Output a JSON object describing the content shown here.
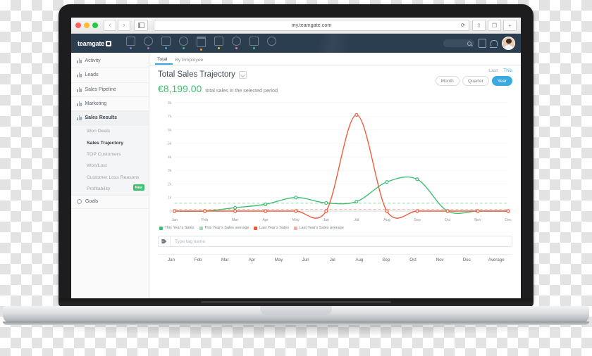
{
  "browser": {
    "url": "my.teamgate.com",
    "back_label": "‹",
    "forward_label": "›",
    "reload_label": "⟳",
    "sidebar_toggle_name": "sidebar-toggle",
    "share_label": "⇧",
    "tabs_label": "❐"
  },
  "appnav": {
    "logo_text": "teamgate",
    "icons": [
      {
        "name": "dashboard-icon",
        "dot": "#8e6fd8",
        "shape": "grid"
      },
      {
        "name": "leads-icon",
        "dot": "#c45fd0",
        "shape": "circ"
      },
      {
        "name": "pipeline-icon",
        "dot": "#4aa3e0",
        "shape": "grid"
      },
      {
        "name": "contacts-icon",
        "dot": "#3fbf72",
        "shape": "circ"
      },
      {
        "name": "deals-icon",
        "dot": "#f0922b",
        "shape": "brief"
      },
      {
        "name": "calendar-icon",
        "dot": "#f0c419",
        "shape": "grid"
      },
      {
        "name": "reports-icon",
        "dot": "#e87fae",
        "shape": "circ"
      },
      {
        "name": "library-icon",
        "dot": "#3fbf72",
        "shape": "grid"
      },
      {
        "name": "settings-icon",
        "dot": "",
        "shape": "circ"
      }
    ],
    "search_placeholder": "",
    "notes_icon": "notes-icon",
    "bell_icon": "bell-icon",
    "avatar_name": "user-avatar"
  },
  "sidebar": {
    "items": [
      {
        "label": "Activity",
        "icon": "bar-chart-icon",
        "active": false
      },
      {
        "label": "Leads",
        "icon": "bar-chart-icon",
        "active": false
      },
      {
        "label": "Sales Pipeline",
        "icon": "bar-chart-icon",
        "active": false
      },
      {
        "label": "Marketing",
        "icon": "bar-chart-icon",
        "active": false
      },
      {
        "label": "Sales Results",
        "icon": "bar-chart-icon",
        "active": true
      }
    ],
    "subitems": [
      {
        "label": "Won Deals",
        "selected": false,
        "badge": ""
      },
      {
        "label": "Sales Trajectory",
        "selected": true,
        "badge": ""
      },
      {
        "label": "TOP Customers",
        "selected": false,
        "badge": ""
      },
      {
        "label": "Won/Lost",
        "selected": false,
        "badge": ""
      },
      {
        "label": "Customer Loss Reasons",
        "selected": false,
        "badge": ""
      },
      {
        "label": "Profitability",
        "selected": false,
        "badge": "New"
      }
    ],
    "footer_item": {
      "label": "Goals",
      "icon": "gear-icon"
    }
  },
  "main": {
    "tabs": [
      {
        "label": "Total",
        "active": true
      },
      {
        "label": "By Employee",
        "active": false
      }
    ],
    "title": "Total Sales Trajectory",
    "edit_icon": "expand-icon",
    "amount": "€8,199.00",
    "amount_label": "total sales in the selected period",
    "period_scope": [
      {
        "label": "Last",
        "active": false
      },
      {
        "label": "This",
        "active": true
      }
    ],
    "period_range": [
      {
        "label": "Month",
        "active": false
      },
      {
        "label": "Quarter",
        "active": false
      },
      {
        "label": "Year",
        "active": true
      }
    ],
    "tag_input": {
      "placeholder": "Type tag name",
      "value": "",
      "icon": "tag-icon"
    },
    "table_headers": [
      "Jan",
      "Feb",
      "Mar",
      "Apr",
      "May",
      "Jun",
      "Jul",
      "Aug",
      "Sep",
      "Oct",
      "Nov",
      "Dec",
      "Average"
    ]
  },
  "colors": {
    "accent": "#3aa9e0",
    "green": "#3fbf72",
    "red": "#f05a3c",
    "navy": "#2b3e50"
  },
  "chart_data": {
    "type": "line",
    "title": "Total Sales Trajectory",
    "xlabel": "",
    "ylabel": "",
    "ylim": [
      0,
      8000
    ],
    "ytick_labels": [
      "0",
      "1k",
      "2k",
      "3k",
      "4k",
      "5k",
      "6k",
      "7k",
      "8k"
    ],
    "ytick_values": [
      0,
      1000,
      2000,
      3000,
      4000,
      5000,
      6000,
      7000,
      8000
    ],
    "grid": true,
    "legend_position": "bottom-left",
    "categories": [
      "Jan",
      "Feb",
      "Mar",
      "Apr",
      "May",
      "Jun",
      "Jul",
      "Aug",
      "Sep",
      "Oct",
      "Nov",
      "Dec"
    ],
    "series": [
      {
        "name": "This Year's Sales",
        "color": "#3fbf72",
        "style": "solid",
        "values": [
          0,
          0,
          250,
          500,
          1000,
          600,
          700,
          2150,
          2350,
          0,
          0,
          0
        ]
      },
      {
        "name": "This Year's Sales average",
        "color": "#9fd9b4",
        "style": "dashed",
        "value": 580
      },
      {
        "name": "Last Year's Sales",
        "color": "#f05a3c",
        "style": "solid",
        "values": [
          0,
          0,
          0,
          0,
          0,
          0,
          7100,
          0,
          0,
          0,
          0,
          0
        ]
      },
      {
        "name": "Last Year's Sales average",
        "color": "#f6b0a2",
        "style": "dashed",
        "value": 120
      }
    ]
  }
}
